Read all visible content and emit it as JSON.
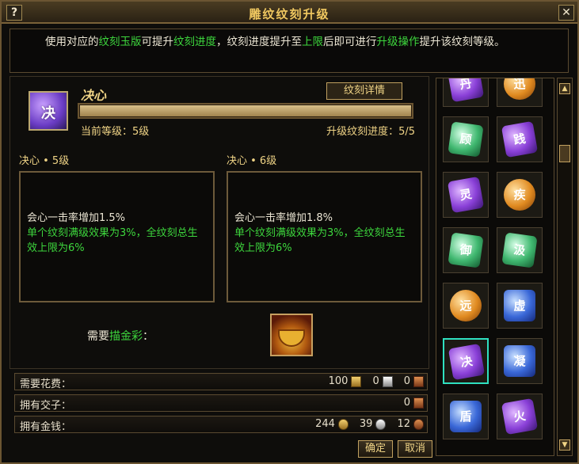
{
  "window": {
    "title": "雕纹纹刻升级",
    "help_label": "?",
    "close_label": "✕"
  },
  "description": {
    "p1": "使用对应的",
    "g1": "纹刻玉版",
    "p2": "可提升",
    "g2": "纹刻进度",
    "p3": "，纹刻进度提升至",
    "g3": "上限",
    "p4": "后即可进行",
    "g4": "升级操作",
    "p5": "提升该纹刻等级。"
  },
  "skill": {
    "icon_char": "决",
    "name": "决心",
    "detail_button": "纹刻详情",
    "progress_fraction": 1.0,
    "current_level": "当前等级：5级",
    "upgrade_progress": "升级纹刻进度：5/5"
  },
  "current": {
    "header": "决心 • 5级",
    "line1": "会心一击率增加1.5%",
    "line2": "单个纹刻满级效果为3%，全纹刻总生效上限为6%"
  },
  "next": {
    "header": "决心 • 6级",
    "line1": "会心一击率增加1.8%",
    "line2": "单个纹刻满级效果为3%，全纹刻总生效上限为6%"
  },
  "need": {
    "prefix": "需要",
    "item": "描金彩",
    "suffix": "："
  },
  "costs": {
    "fee": {
      "label": "需要花费：",
      "gold": "100",
      "silver": "0",
      "copper": "0"
    },
    "jiaozi": {
      "label": "拥有交子：",
      "value": "0"
    },
    "money": {
      "label": "拥有金钱：",
      "gold": "244",
      "silver": "39",
      "copper": "12"
    }
  },
  "buttons": {
    "ok": "确定",
    "cancel": "取消"
  },
  "grid_items": [
    {
      "char": "丹",
      "color": "purple"
    },
    {
      "char": "迅",
      "color": "orange"
    },
    {
      "char": "顾",
      "color": "green"
    },
    {
      "char": "践",
      "color": "purple"
    },
    {
      "char": "灵",
      "color": "purple"
    },
    {
      "char": "疾",
      "color": "orange"
    },
    {
      "char": "御",
      "color": "green"
    },
    {
      "char": "汲",
      "color": "green"
    },
    {
      "char": "远",
      "color": "orange"
    },
    {
      "char": "虚",
      "color": "blue"
    },
    {
      "char": "决",
      "color": "purple"
    },
    {
      "char": "凝",
      "color": "blue"
    },
    {
      "char": "盾",
      "color": "blue"
    },
    {
      "char": "火",
      "color": "purple"
    }
  ],
  "scrollbar": {
    "up": "▲",
    "down": "▼"
  }
}
